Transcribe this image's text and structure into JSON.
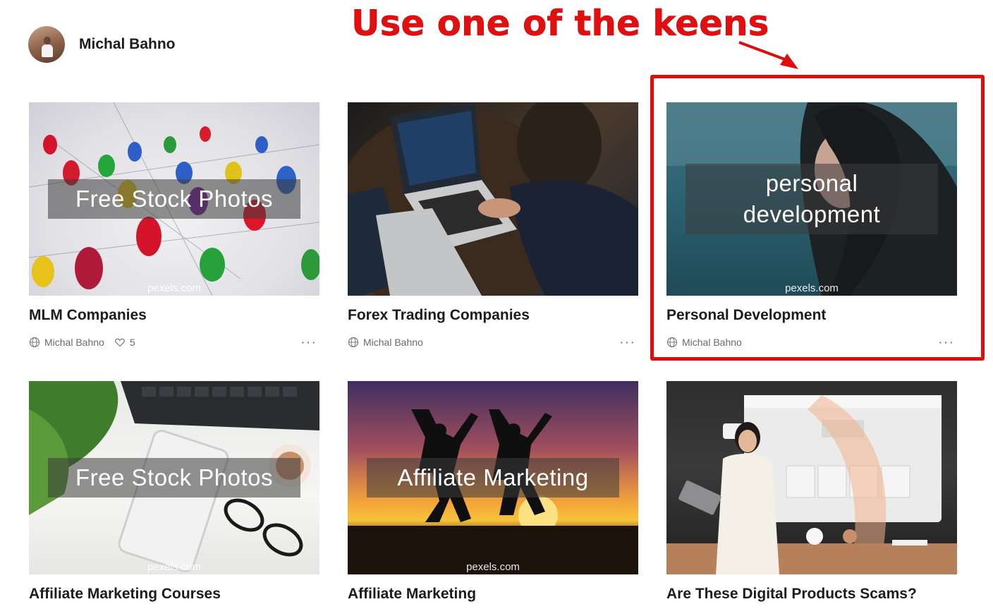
{
  "header": {
    "user_name": "Michal Bahno"
  },
  "annotation": {
    "text": "Use one of the keens",
    "color": "#e00d0d"
  },
  "cards": [
    {
      "title": "MLM Companies",
      "author": "Michal Bahno",
      "likes": "5",
      "banner": "Free Stock Photos",
      "watermark": "pexels.com"
    },
    {
      "title": "Forex Trading Companies",
      "author": "Michal Bahno"
    },
    {
      "title": "Personal Development",
      "author": "Michal Bahno",
      "banner_line1": "personal",
      "banner_line2": "development",
      "watermark": "pexels.com"
    },
    {
      "title": "Affiliate Marketing Courses",
      "banner": "Free Stock Photos",
      "watermark": "pexels.com"
    },
    {
      "title": "Affiliate Marketing",
      "banner": "Affiliate Marketing",
      "watermark": "pexels.com"
    },
    {
      "title": "Are These Digital Products Scams?"
    }
  ],
  "more_glyph": "···",
  "icons": {
    "globe": "globe-icon",
    "heart": "heart-icon",
    "more": "more-icon"
  }
}
